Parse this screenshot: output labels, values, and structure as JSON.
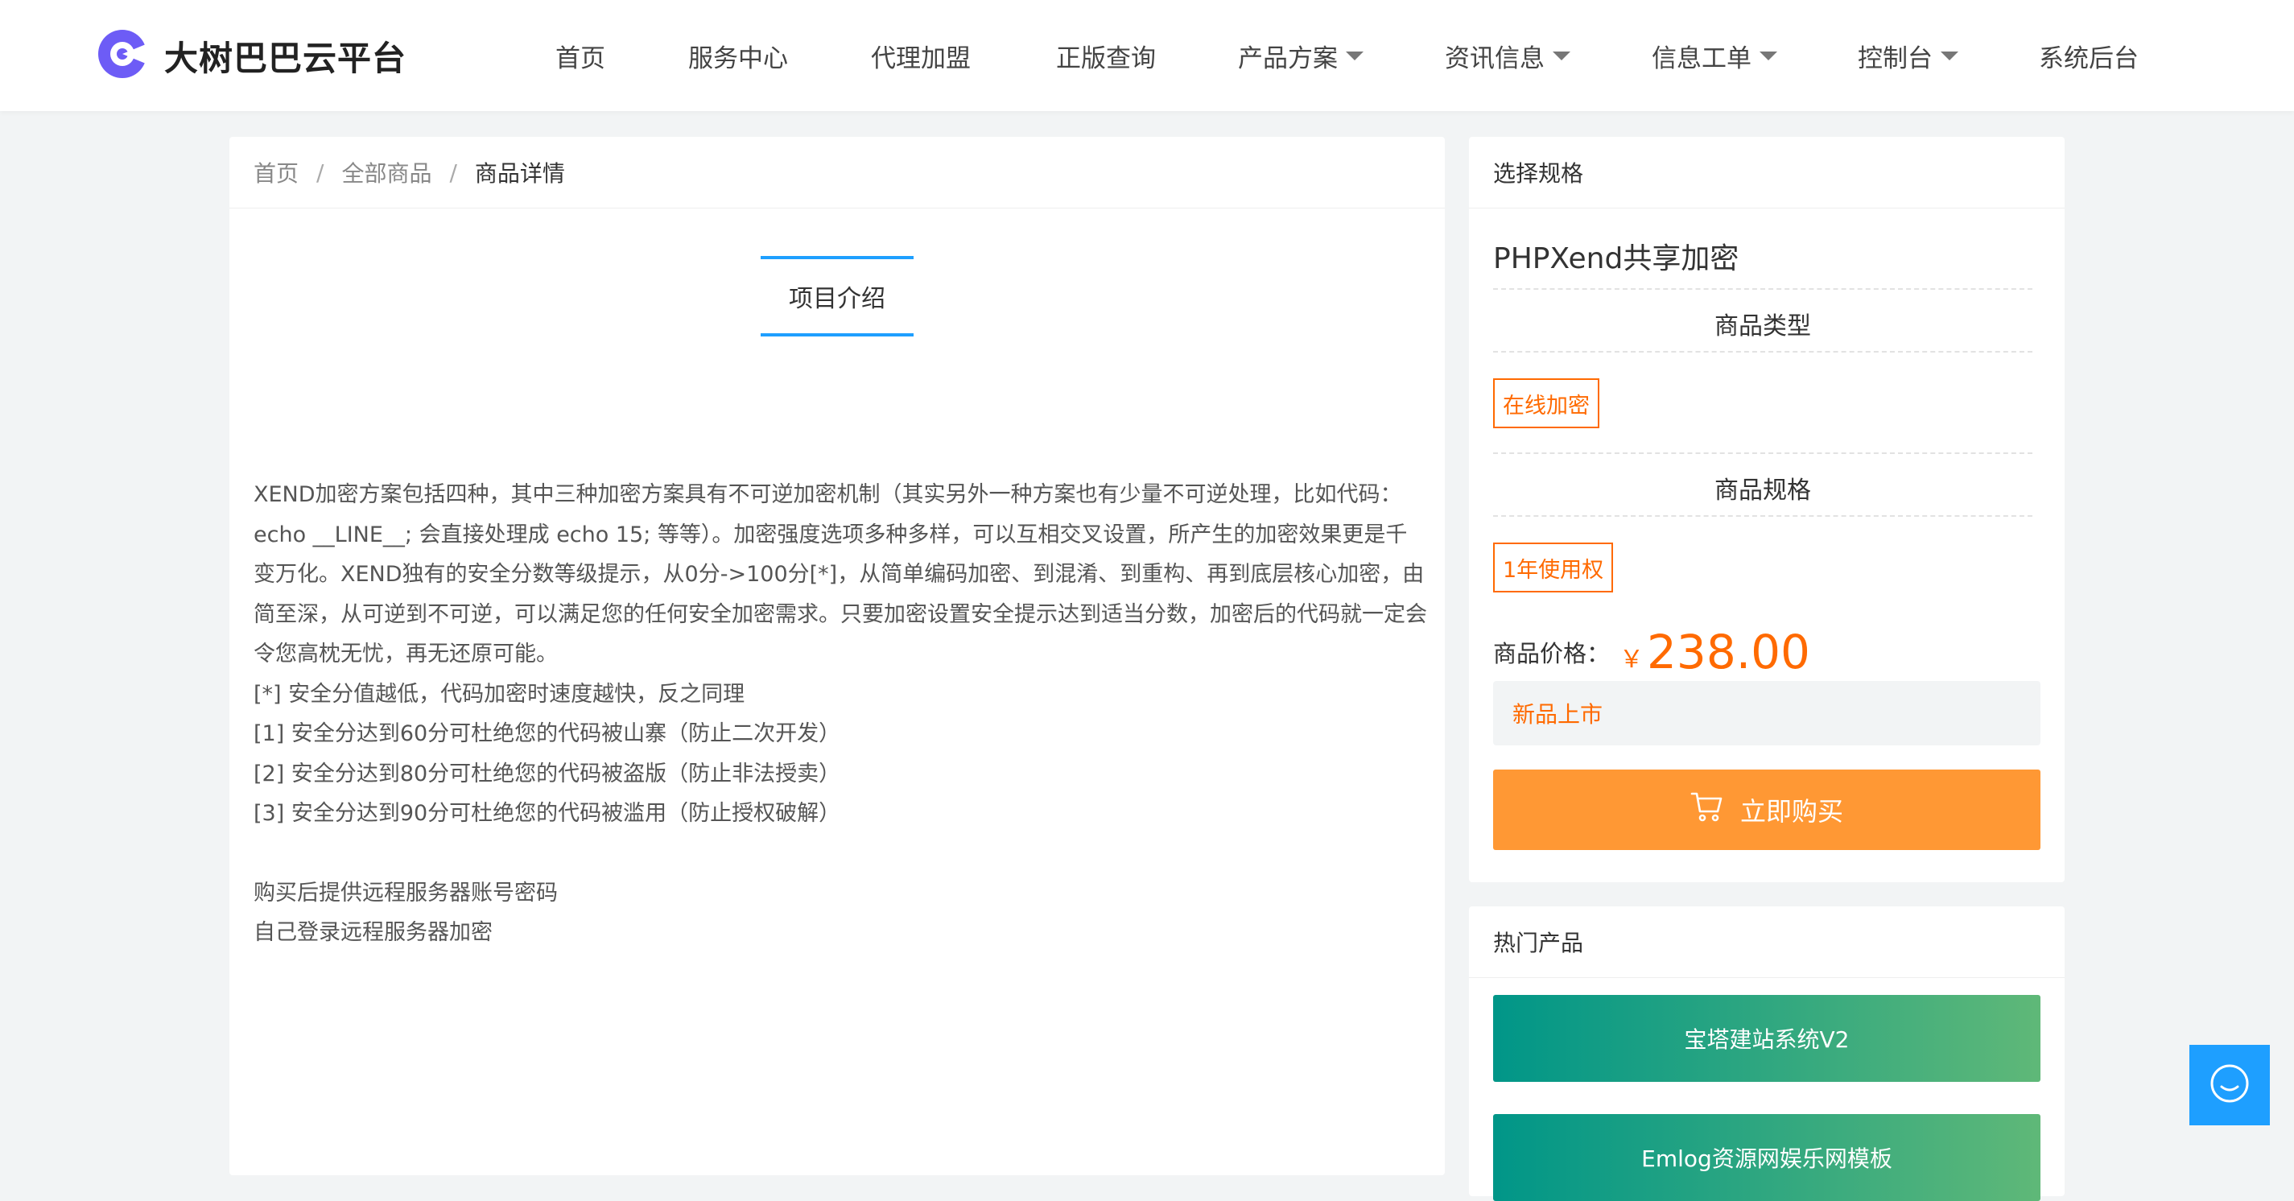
{
  "brand": {
    "name": "大树巴巴云平台",
    "accent": "#6d5cf6"
  },
  "nav": {
    "items": [
      {
        "label": "首页",
        "dropdown": false
      },
      {
        "label": "服务中心",
        "dropdown": false
      },
      {
        "label": "代理加盟",
        "dropdown": false
      },
      {
        "label": "正版查询",
        "dropdown": false
      },
      {
        "label": "产品方案",
        "dropdown": true
      },
      {
        "label": "资讯信息",
        "dropdown": true
      },
      {
        "label": "信息工单",
        "dropdown": true
      },
      {
        "label": "控制台",
        "dropdown": true
      },
      {
        "label": "系统后台",
        "dropdown": false
      }
    ]
  },
  "breadcrumb": {
    "home": "首页",
    "all": "全部商品",
    "current": "商品详情",
    "separator": "/"
  },
  "detail": {
    "tab_label": "项目介绍",
    "paragraphs": [
      "XEND加密方案包括四种，其中三种加密方案具有不可逆加密机制（其实另外一种方案也有少量不可逆处理，比如代码：echo __LINE__; 会直接处理成 echo 15; 等等）。加密强度选项多种多样，可以互相交叉设置，所产生的加密效果更是千变万化。XEND独有的安全分数等级提示，从0分->100分[*]，从简单编码加密、到混淆、到重构、再到底层核心加密，由简至深，从可逆到不可逆，可以满足您的任何安全加密需求。只要加密设置安全提示达到适当分数，加密后的代码就一定会令您高枕无忧，再无还原可能。",
      "[*] 安全分值越低，代码加密时速度越快，反之同理",
      "[1] 安全分达到60分可杜绝您的代码被山寨（防止二次开发）",
      "[2] 安全分达到80分可杜绝您的代码被盗版（防止非法授卖）",
      "[3] 安全分达到90分可杜绝您的代码被滥用（防止授权破解）"
    ],
    "notes": [
      "购买后提供远程服务器账号密码",
      "自己登录远程服务器加密"
    ]
  },
  "spec": {
    "panel_title": "选择规格",
    "product_name": "PHPXend共享加密",
    "type_title": "商品类型",
    "type_option": "在线加密",
    "spec_title": "商品规格",
    "spec_option": "1年使用权",
    "price_label": "商品价格：",
    "currency": "￥",
    "price": "238.00",
    "notice": "新品上市",
    "buy_label": "立即购买",
    "price_color": "#ff6a00",
    "button_color": "#ff9834"
  },
  "hot": {
    "title": "热门产品",
    "items": [
      "宝塔建站系统V2",
      "Emlog资源网娱乐网模板"
    ]
  },
  "icons": {
    "logo": "logo-icon",
    "cart": "cart-icon",
    "chat": "chat-icon",
    "caret": "chevron-down-icon"
  }
}
